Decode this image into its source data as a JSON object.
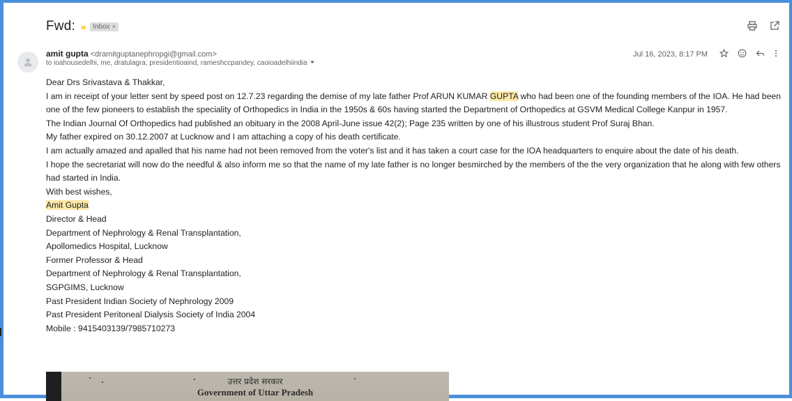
{
  "email": {
    "subject": "Fwd:",
    "label": "Inbox",
    "label_close": "×",
    "sender_name": "amit gupta",
    "sender_email": "<dramitguptanephropgi@gmail.com>",
    "recipients": "to ioahousedelhi, me, dratulagra, presidentioaind, rameshccpandey, caoioadelhiindia",
    "date": "Jul 16, 2023, 8:17 PM"
  },
  "icons": {
    "importance": "importance-marker-icon",
    "print": "print-icon",
    "open_new_window": "open-in-new-window-icon",
    "avatar": "person-icon",
    "recipients_dropdown": "chevron-down-icon",
    "star": "star-icon",
    "emoji": "emoji-reaction-icon",
    "reply": "reply-icon",
    "more": "more-vertical-icon"
  },
  "body": {
    "greeting": "Dear Drs Srivastava & Thakkar,",
    "p1_before": "I am in receipt of your letter sent by speed post on 12.7.23 regarding the demise of my late father Prof ARUN KUMAR ",
    "p1_highlight": "GUPTA",
    "p1_after": " who had been one of the founding members of the IOA. He had been one of the few pioneers to establish the speciality of Orthopedics in India in the 1950s & 60s having started the Department of Orthopedics at GSVM Medical College Kanpur in 1957.",
    "p2": "The Indian Journal Of Orthopedics had published an obituary in the 2008 April-June issue 42(2); Page 235 written by one of his illustrous student Prof Suraj Bhan.",
    "p3": "My father expired on 30.12.2007 at Lucknow and I am attaching a copy of his death certificate.",
    "p4": "I am actually amazed and apalled that his name had not been removed from the voter's list and it has taken a court case for the IOA headquarters to enquire about the date of his death.",
    "p5": "I hope the secretariat will now do the needful & also inform me so that the name of my late father is no longer besmirched by the members of the the very organization that he along with few others had started in India.",
    "closing": "With best wishes,",
    "signature_name": "Amit Gupta",
    "signature_lines": [
      "Director & Head",
      "Department of Nephrology & Renal Transplantation,",
      "Apollomedics Hospital, Lucknow",
      "Former Professor & Head",
      "Department of Nephrology & Renal Transplantation,",
      "SGPGIMS, Lucknow",
      "Past President Indian Society of Nephrology 2009",
      "Past President Peritoneal Dialysis Society of India 2004",
      "Mobile : 9415403139/7985710273"
    ]
  },
  "attachment": {
    "hindi_heading": "उत्तर प्रदेश सरकार",
    "heading": "Government of Uttar Pradesh"
  },
  "colors": {
    "frame_border": "#4a8fdc",
    "highlight": "#fce8a6",
    "importance": "#f4b400"
  }
}
